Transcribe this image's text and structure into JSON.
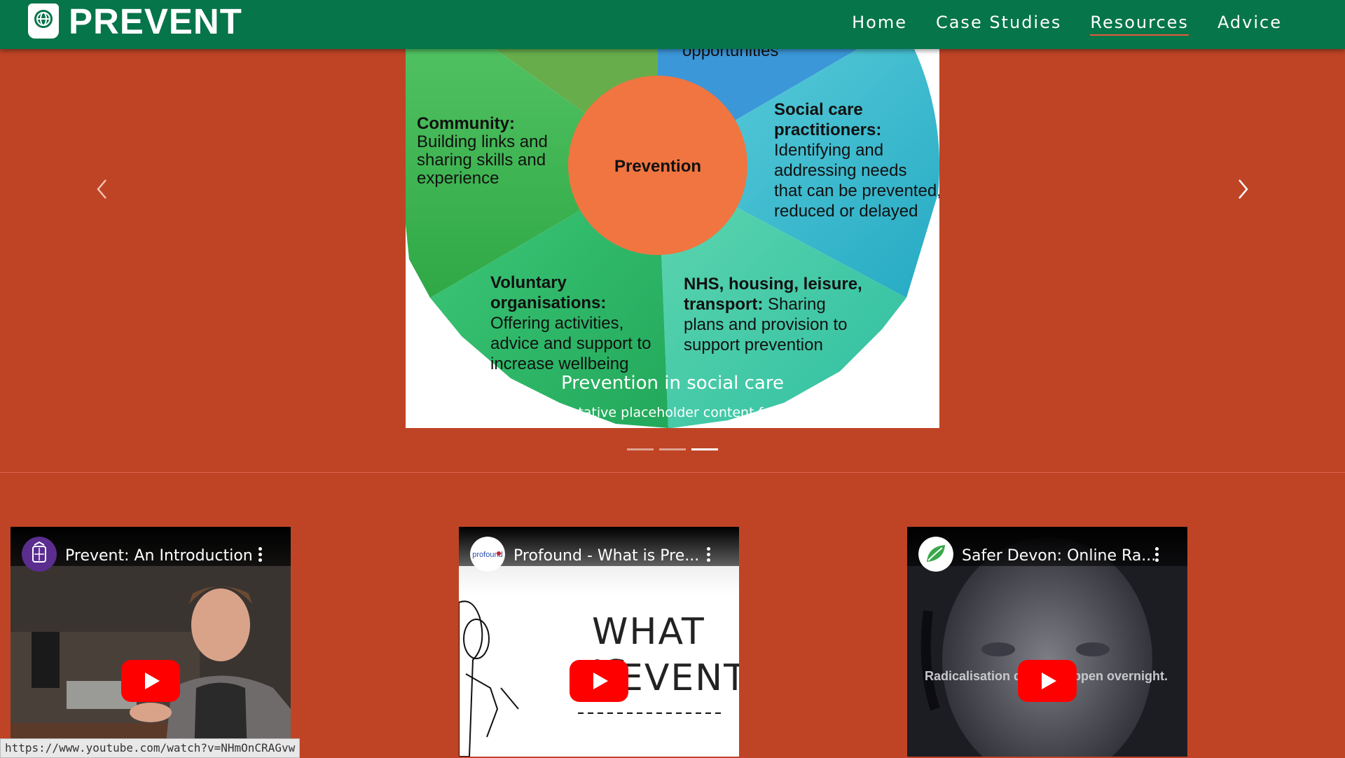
{
  "brand": {
    "name": "PREVENT",
    "icon": "globe-book-icon"
  },
  "nav": {
    "items": [
      {
        "label": "Home"
      },
      {
        "label": "Case Studies"
      },
      {
        "label": "Resources"
      },
      {
        "label": "Advice"
      }
    ],
    "active": "Resources"
  },
  "carousel": {
    "slide": {
      "center_label": "Prevention",
      "top_right_fragment": "opportunities",
      "community_heading": "Community:",
      "community_lines": [
        "Building links and",
        "sharing skills and",
        "experience"
      ],
      "social_heading_lines": [
        "Social care",
        "practitioners:"
      ],
      "social_lines": [
        "Identifying and",
        "addressing needs",
        "that can be prevented,",
        "reduced or delayed"
      ],
      "voluntary_heading_lines": [
        "Voluntary",
        "organisations:"
      ],
      "voluntary_lines": [
        "Offering activities,",
        "advice and support to",
        "increase wellbeing"
      ],
      "nhs_heading_lines": [
        "NHS, housing, leisure,",
        "transport:"
      ],
      "nhs_inline": " Sharing",
      "nhs_lines": [
        "plans and provision to",
        "support prevention"
      ]
    },
    "caption_title": "Prevention in social care",
    "caption_text": "presentative placeholder content for the t",
    "prev_icon": "chevron-left-icon",
    "next_icon": "chevron-right-icon",
    "indicators": [
      false,
      false,
      true
    ],
    "colors": {
      "orange": "#f07540",
      "green_dark": "#3aa84a",
      "blue": "#3b9cd6",
      "teal": "#4ac7cf"
    }
  },
  "videos": [
    {
      "title": "Prevent: An Introduction",
      "avatar": "home-office-crest-icon",
      "menu": "more-vert-icon"
    },
    {
      "title": "Profound - What is Pre...",
      "avatar": "profound-logo-icon",
      "menu": "more-vert-icon",
      "thumb_text_1": "WHAT IS",
      "thumb_text_2": "EVENT?"
    },
    {
      "title": "Safer Devon: Online Ra...",
      "avatar": "leaf-logo-icon",
      "menu": "more-vert-icon",
      "thumb_overlay_left": "Radicalisation d",
      "thumb_overlay_right": "ppen overnight."
    }
  ],
  "status_bar": {
    "url": "https://www.youtube.com/watch?v=NHmOnCRAGvw"
  }
}
